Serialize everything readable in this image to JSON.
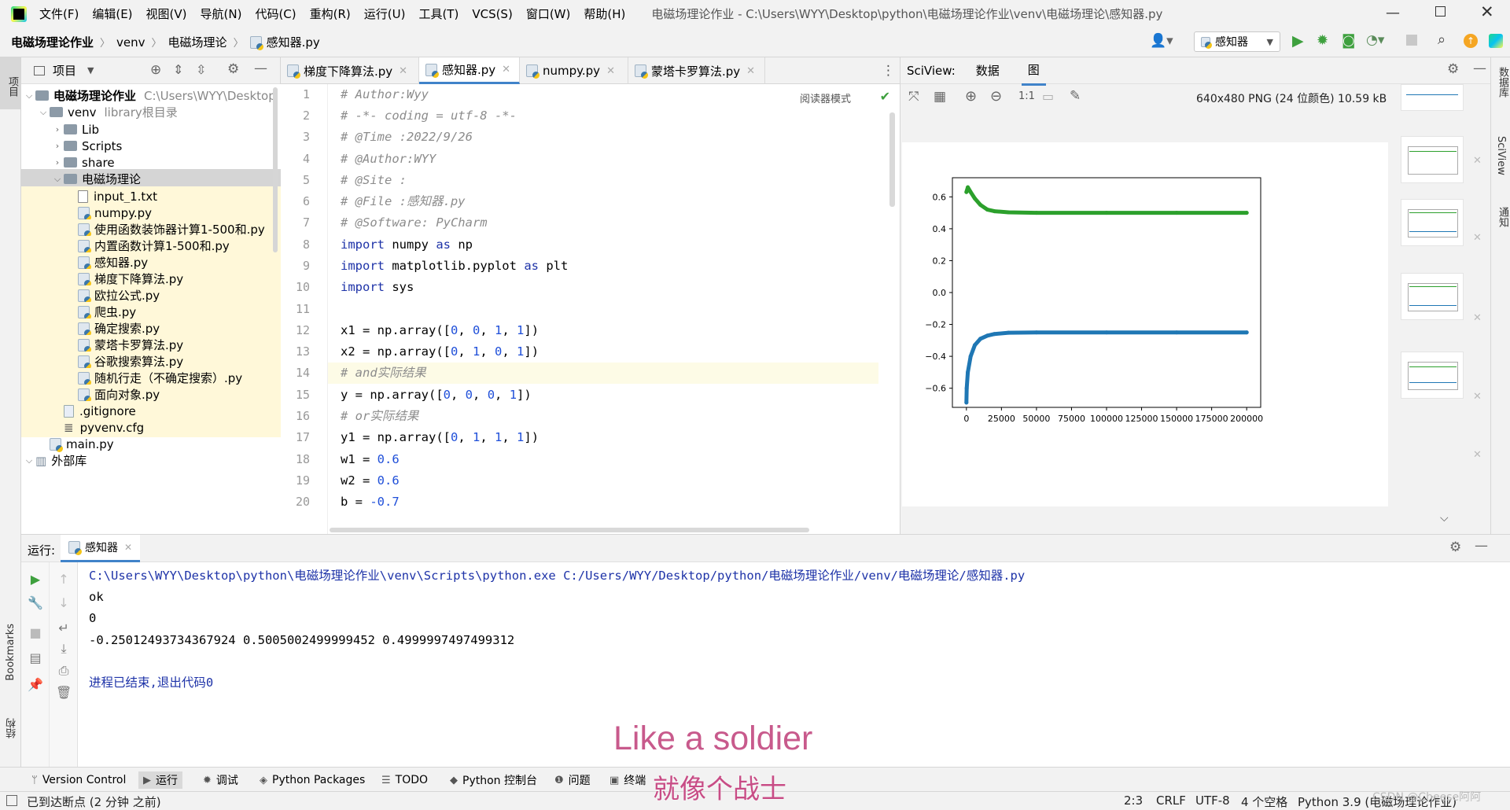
{
  "menubar": {
    "items": [
      "文件(F)",
      "编辑(E)",
      "视图(V)",
      "导航(N)",
      "代码(C)",
      "重构(R)",
      "运行(U)",
      "工具(T)",
      "VCS(S)",
      "窗口(W)",
      "帮助(H)"
    ],
    "window_title": "电磁场理论作业 - C:\\Users\\WYY\\Desktop\\python\\电磁场理论作业\\venv\\电磁场理论\\感知器.py"
  },
  "navbar": {
    "breadcrumbs": [
      "电磁场理论作业",
      "venv",
      "电磁场理论",
      "感知器.py"
    ],
    "run_config": "感知器"
  },
  "project": {
    "title": "项目",
    "tree": [
      {
        "label": "电磁场理论作业",
        "extra": "C:\\Users\\WYY\\Desktop"
      },
      {
        "label": "venv",
        "extra": "library根目录"
      },
      {
        "label": "Lib"
      },
      {
        "label": "Scripts"
      },
      {
        "label": "share"
      },
      {
        "label": "电磁场理论"
      },
      {
        "label": "input_1.txt"
      },
      {
        "label": "numpy.py"
      },
      {
        "label": "使用函数装饰器计算1-500和.py"
      },
      {
        "label": "内置函数计算1-500和.py"
      },
      {
        "label": "感知器.py"
      },
      {
        "label": "梯度下降算法.py"
      },
      {
        "label": "欧拉公式.py"
      },
      {
        "label": "爬虫.py"
      },
      {
        "label": "确定搜索.py"
      },
      {
        "label": "蒙塔卡罗算法.py"
      },
      {
        "label": "谷歌搜索算法.py"
      },
      {
        "label": "随机行走（不确定搜索）.py"
      },
      {
        "label": "面向对象.py"
      },
      {
        "label": ".gitignore"
      },
      {
        "label": "pyvenv.cfg"
      },
      {
        "label": "main.py"
      },
      {
        "label": "外部库"
      }
    ]
  },
  "editor": {
    "tabs": [
      "梯度下降算法.py",
      "感知器.py",
      "numpy.py",
      "蒙塔卡罗算法.py"
    ],
    "reader_mode": "阅读器模式",
    "line_numbers": [
      "1",
      "2",
      "3",
      "4",
      "5",
      "6",
      "7",
      "8",
      "9",
      "10",
      "11",
      "12",
      "13",
      "14",
      "15",
      "16",
      "17",
      "18",
      "19",
      "20"
    ],
    "lines": [
      "# Author:Wyy",
      "# -*- coding = utf-8 -*-",
      "# @Time :2022/9/26",
      "# @Author:WYY",
      "# @Site :",
      "# @File :感知器.py",
      "# @Software: PyCharm",
      "import numpy as np",
      "import matplotlib.pyplot as plt",
      "import sys",
      "",
      "x1 = np.array([0, 0, 1, 1])",
      "x2 = np.array([0, 1, 0, 1])",
      "# and实际结果",
      "y = np.array([0, 0, 0, 1])",
      "# or实际结果",
      "y1 = np.array([0, 1, 1, 1])",
      "w1 = 0.6",
      "w2 = 0.6",
      "b = -0.7"
    ]
  },
  "sciview": {
    "label": "SciView:",
    "tabs": [
      "数据",
      "图"
    ],
    "image_info": "640x480 PNG (24 位颜色) 10.59 kB",
    "zoom_label": "1:1"
  },
  "chart_data": {
    "type": "scatter",
    "x_ticks": [
      "0",
      "25000",
      "50000",
      "75000",
      "100000",
      "125000",
      "150000",
      "175000",
      "200000"
    ],
    "y_ticks": [
      "0.6",
      "0.4",
      "0.2",
      "0.0",
      "−0.2",
      "−0.4",
      "−0.6"
    ],
    "xlim": [
      -10000,
      210000
    ],
    "ylim": [
      -0.72,
      0.72
    ],
    "series": [
      {
        "color": "#2ca02c",
        "x": [
          0,
          1000,
          3000,
          6000,
          10000,
          15000,
          20000,
          30000,
          50000,
          100000,
          150000,
          200000
        ],
        "y": [
          0.63,
          0.66,
          0.63,
          0.59,
          0.55,
          0.52,
          0.51,
          0.503,
          0.5,
          0.5,
          0.5,
          0.5
        ]
      },
      {
        "color": "#1f77b4",
        "x": [
          0,
          200,
          1000,
          3000,
          6000,
          10000,
          15000,
          20000,
          30000,
          50000,
          100000,
          150000,
          200000
        ],
        "y": [
          -0.69,
          -0.6,
          -0.5,
          -0.4,
          -0.33,
          -0.29,
          -0.27,
          -0.26,
          -0.252,
          -0.25,
          -0.25,
          -0.25,
          -0.25
        ]
      }
    ]
  },
  "run": {
    "label": "运行:",
    "tab": "感知器",
    "console": [
      "C:\\Users\\WYY\\Desktop\\python\\电磁场理论作业\\venv\\Scripts\\python.exe C:/Users/WYY/Desktop/python/电磁场理论作业/venv/电磁场理论/感知器.py",
      "ok",
      "0",
      "-0.25012493734367924 0.5005002499999452 0.4999997497499312",
      "",
      "进程已结束,退出代码0"
    ]
  },
  "bottom_tabs": [
    "Version Control",
    "运行",
    "调试",
    "Python Packages",
    "TODO",
    "Python 控制台",
    "问题",
    "终端"
  ],
  "statusbar": {
    "message": "已到达断点 (2 分钟 之前)",
    "position": "2:3",
    "line_sep": "CRLF",
    "encoding": "UTF-8",
    "indent": "4 个空格",
    "interpreter": "Python 3.9 (电磁场理论作业)"
  },
  "side_labels": {
    "left_top": "项目",
    "left_bookmarks": "Bookmarks",
    "left_structure": "结构",
    "right": [
      "数据库",
      "SciView",
      "通知"
    ]
  },
  "subtitles": {
    "en": "Like a soldier",
    "zh": "就像个战士"
  },
  "watermark": "CSDN @Cheese阿阿",
  "colors": {
    "accent": "#4083c9",
    "green_series": "#2ca02c",
    "blue_series": "#1f77b4"
  }
}
